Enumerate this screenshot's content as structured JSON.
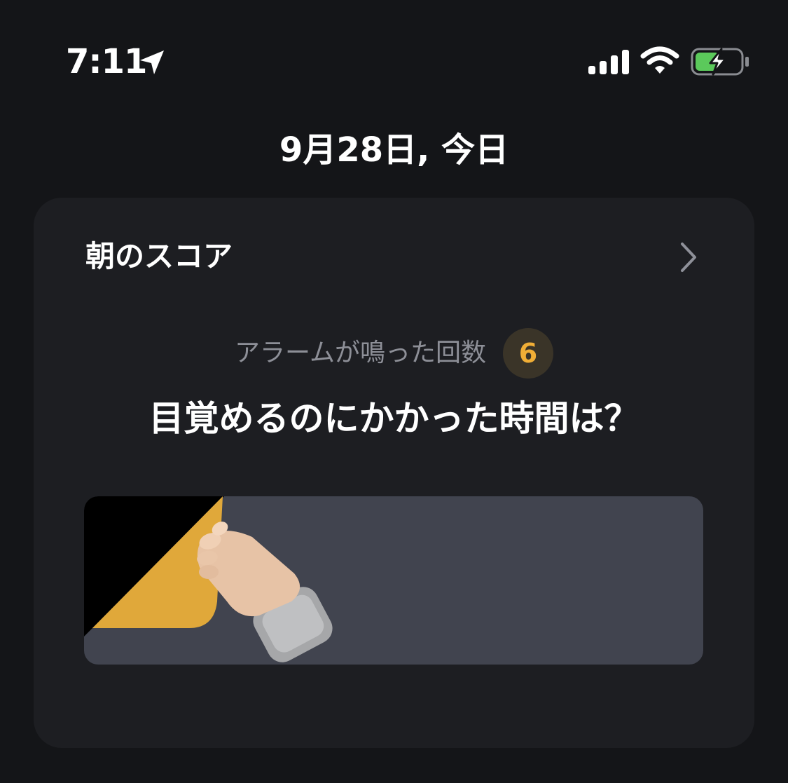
{
  "status_bar": {
    "time": "7:11",
    "icons": [
      "location-arrow-icon",
      "cellular-signal-icon",
      "wifi-icon",
      "battery-charging-icon"
    ],
    "battery_color": "#5bc95b"
  },
  "header": {
    "date": "9月28日, 今日"
  },
  "card": {
    "title": "朝のスコア",
    "chevron": "chevron-right-icon",
    "snooze_label": "アラームが鳴った回数",
    "snooze_count": "6",
    "question": "目覚めるのにかかった時間は？",
    "banner": {
      "art": "peel-sticker-hand-illustration",
      "accent_color": "#e0a83a",
      "background_color": "#41444f"
    }
  },
  "colors": {
    "background": "#141518",
    "card": "#1d1e22",
    "muted_text": "#8d8f97",
    "badge_bg": "#3a3428",
    "badge_text": "#f0ae36"
  }
}
